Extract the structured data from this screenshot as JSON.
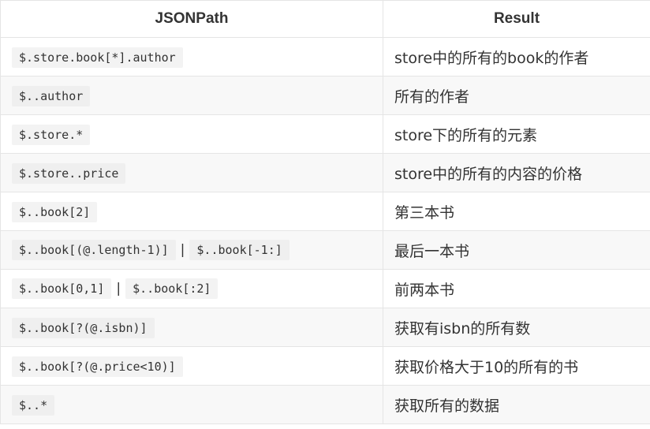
{
  "table": {
    "headers": [
      "JSONPath",
      "Result"
    ],
    "rows": [
      {
        "paths": [
          "$.store.book[*].author"
        ],
        "result": "store中的所有的book的作者"
      },
      {
        "paths": [
          "$..author"
        ],
        "result": "所有的作者"
      },
      {
        "paths": [
          "$.store.*"
        ],
        "result": "store下的所有的元素"
      },
      {
        "paths": [
          "$.store..price"
        ],
        "result": "store中的所有的内容的价格"
      },
      {
        "paths": [
          "$..book[2]"
        ],
        "result": "第三本书"
      },
      {
        "paths": [
          "$..book[(@.length-1)]",
          "$..book[-1:]"
        ],
        "result": "最后一本书"
      },
      {
        "paths": [
          "$..book[0,1]",
          "$..book[:2]"
        ],
        "result": "前两本书"
      },
      {
        "paths": [
          "$..book[?(@.isbn)]"
        ],
        "result": "获取有isbn的所有数"
      },
      {
        "paths": [
          "$..book[?(@.price<10)]"
        ],
        "result": "获取价格大于10的所有的书"
      },
      {
        "paths": [
          "$..*"
        ],
        "result": "获取所有的数据"
      }
    ],
    "separator": "|"
  }
}
